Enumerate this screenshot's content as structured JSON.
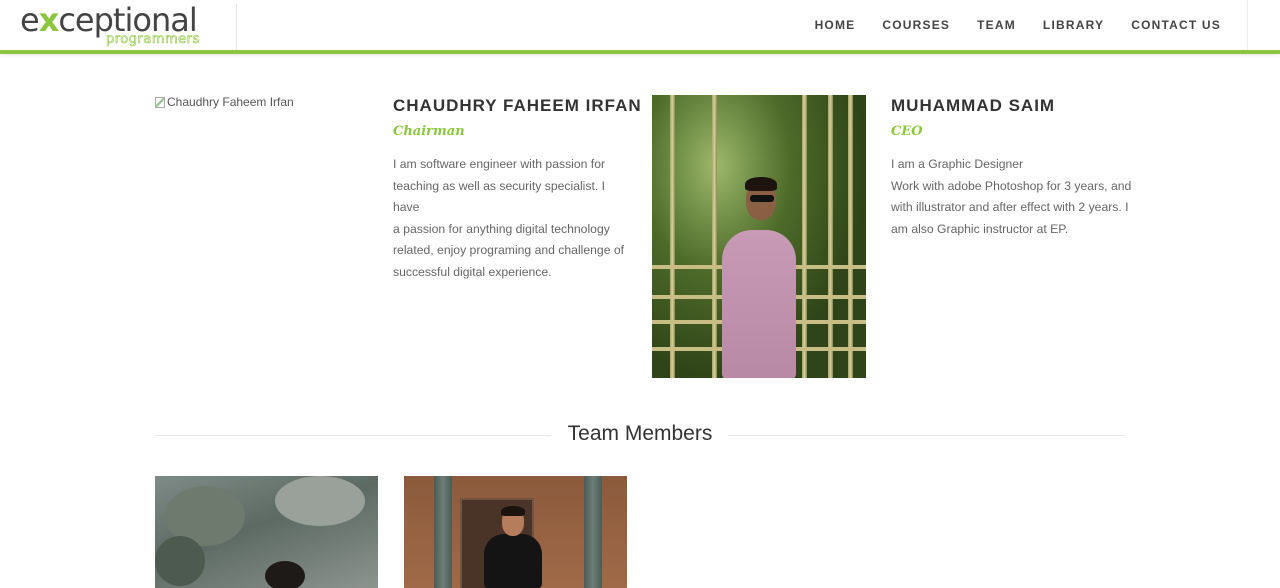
{
  "header": {
    "logo_main_prefix": "e",
    "logo_main_x": "x",
    "logo_main_rest": "ceptional",
    "logo_sub": "programmers",
    "nav": [
      "HOME",
      "COURSES",
      "TEAM",
      "LIBRARY",
      "CONTACT US"
    ]
  },
  "leaders": [
    {
      "image_alt": "Chaudhry Faheem Irfan",
      "name": "CHAUDHRY FAHEEM IRFAN",
      "role": "Chairman",
      "bio": [
        "I am software engineer with passion for",
        "teaching as well as security specialist. I have",
        "a passion for anything digital technology",
        "related, enjoy programing and challenge of",
        "successful digital experience."
      ]
    },
    {
      "name": "MUHAMMAD SAIM",
      "role": "CEO",
      "bio": [
        "I am a Graphic Designer",
        "Work with adobe Photoshop for 3 years, and",
        "with illustrator and after effect with 2 years. I",
        "am also Graphic instructor at EP."
      ]
    }
  ],
  "team": {
    "heading": "Team Members"
  },
  "colors": {
    "accent": "#8cc63f",
    "text": "#444444"
  }
}
